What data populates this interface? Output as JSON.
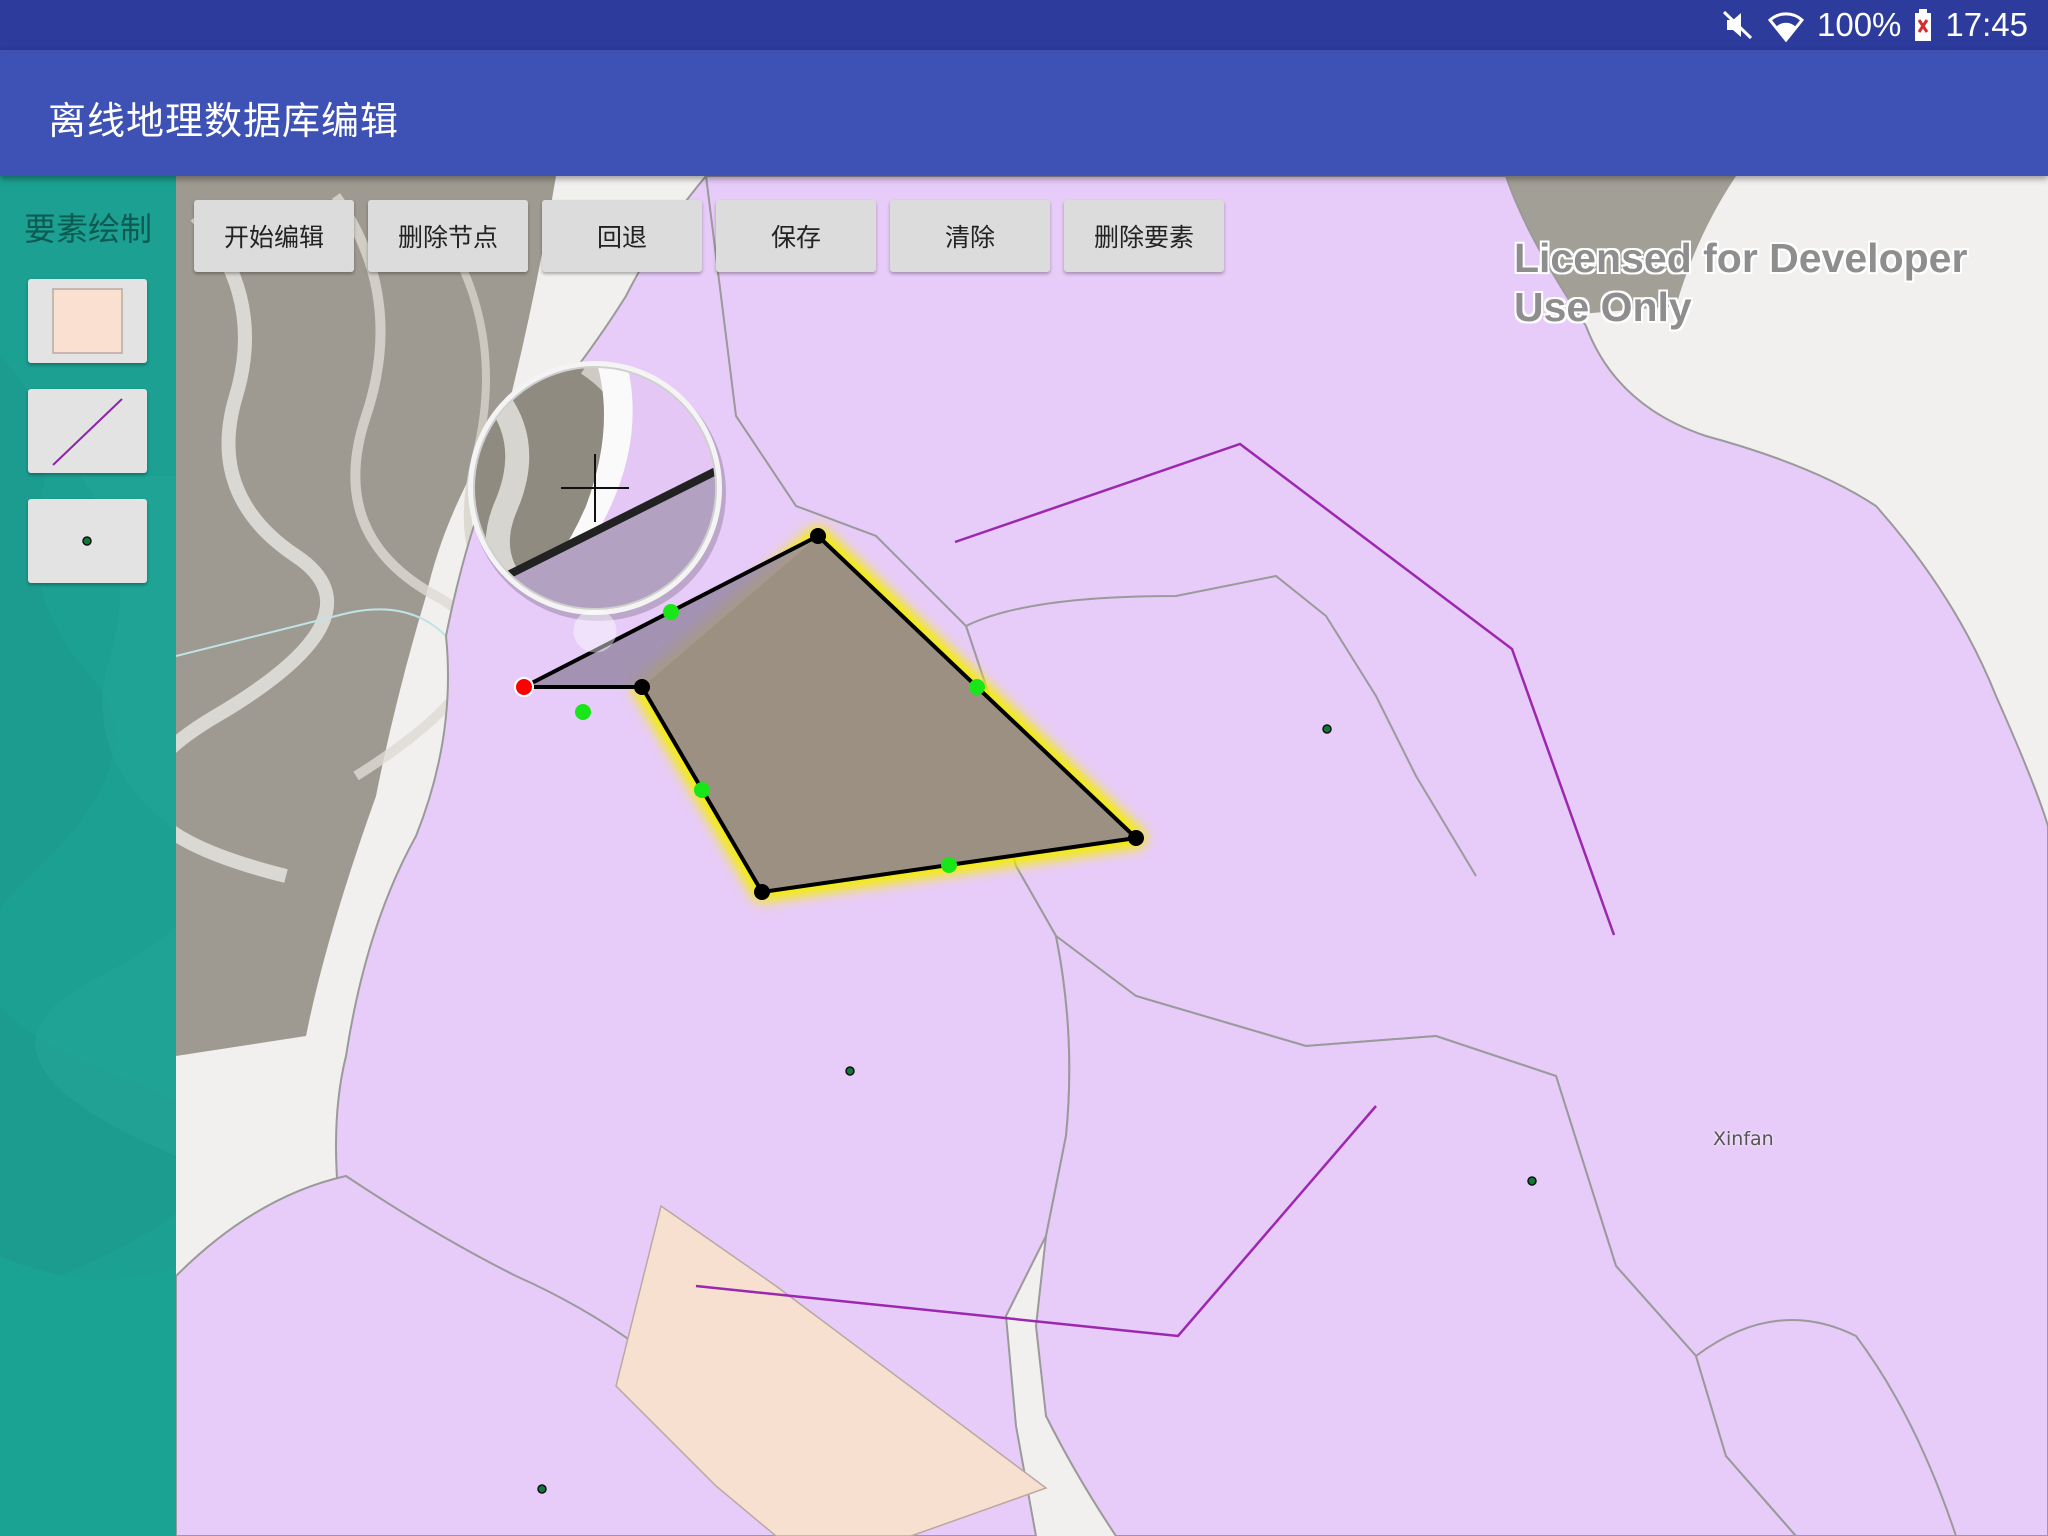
{
  "status_bar": {
    "battery_percent": "100%",
    "time": "17:45",
    "icons": [
      "mute-icon",
      "wifi-icon",
      "battery-icon"
    ]
  },
  "app_bar": {
    "title": "离线地理数据库编辑"
  },
  "side_panel": {
    "label": "要素绘制",
    "tools": [
      {
        "name": "polygon-tool",
        "icon": "polygon-icon"
      },
      {
        "name": "line-tool",
        "icon": "line-icon"
      },
      {
        "name": "point-tool",
        "icon": "point-icon"
      }
    ]
  },
  "toolbar": {
    "start_edit": "开始编辑",
    "delete_vertex": "删除节点",
    "undo": "回退",
    "save": "保存",
    "clear": "清除",
    "delete_feature": "删除要素"
  },
  "map": {
    "watermark_line1": "Licensed for Developer",
    "watermark_line2": "Use Only",
    "place_label": "Xinfan",
    "colors": {
      "feature_fill": "#e7cbf8",
      "feature_outline": "#9a9a9a",
      "sketch_highlight": "#f4ee00",
      "vertex": "#000000",
      "midpoint": "#19e619",
      "selected_vertex": "#ff0000",
      "line_feature": "#9c27b0",
      "polygon_feature": "#f7e0d0"
    }
  }
}
